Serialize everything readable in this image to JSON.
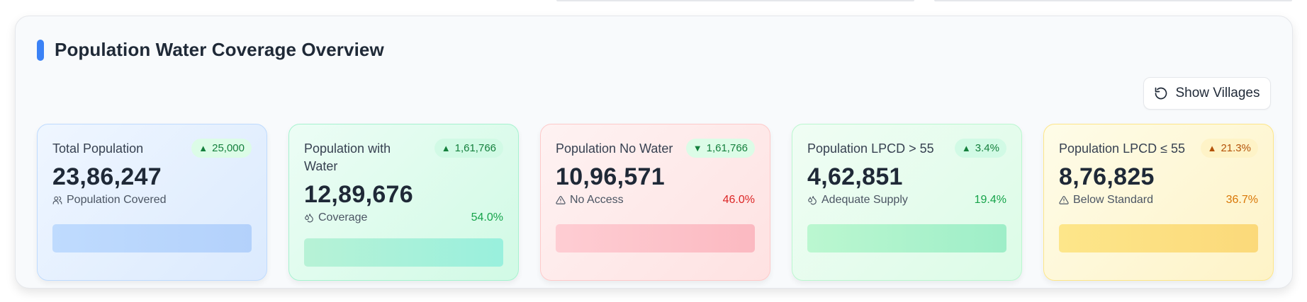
{
  "section": {
    "title": "Population Water Coverage Overview",
    "show_villages_label": "Show Villages"
  },
  "cards": [
    {
      "label": "Total Population",
      "badge": "25,000",
      "badge_dir": "up",
      "value": "23,86,247",
      "sub_label": "Population Covered",
      "sub_icon": "users-icon",
      "percent": ""
    },
    {
      "label": "Population with Water",
      "badge": "1,61,766",
      "badge_dir": "up",
      "value": "12,89,676",
      "sub_label": "Coverage",
      "sub_icon": "droplets-icon",
      "percent": "54.0%"
    },
    {
      "label": "Population No Water",
      "badge": "1,61,766",
      "badge_dir": "down",
      "value": "10,96,571",
      "sub_label": "No Access",
      "sub_icon": "alert-triangle-icon",
      "percent": "46.0%"
    },
    {
      "label": "Population LPCD > 55",
      "badge": "3.4%",
      "badge_dir": "up",
      "value": "4,62,851",
      "sub_label": "Adequate Supply",
      "sub_icon": "droplets-icon",
      "percent": "19.4%"
    },
    {
      "label": "Population LPCD ≤ 55",
      "badge": "21.3%",
      "badge_dir": "up",
      "value": "8,76,825",
      "sub_label": "Below Standard",
      "sub_icon": "alert-triangle-icon",
      "percent": "36.7%"
    }
  ],
  "colors": {
    "accent": "#3b82f6",
    "positive": "#16a34a",
    "negative": "#dc2626",
    "warning": "#d97706"
  }
}
